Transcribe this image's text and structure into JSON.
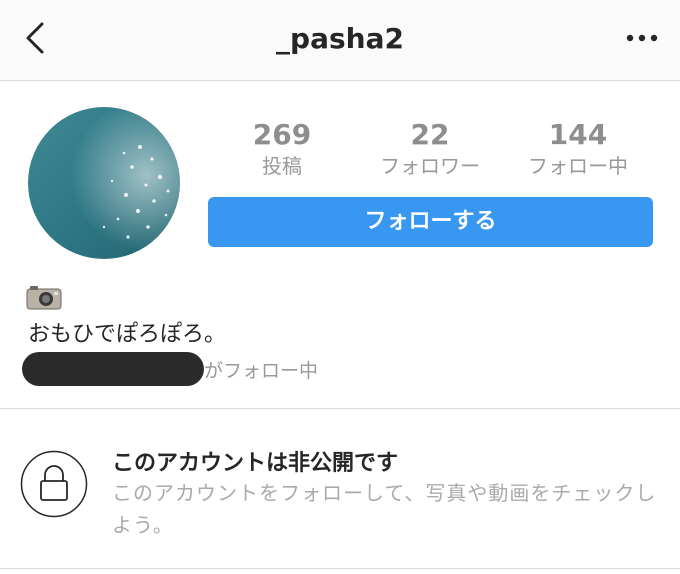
{
  "header": {
    "back_icon": "chevron-left-icon",
    "title": "_pasha2",
    "more_icon": "more-horizontal-icon"
  },
  "profile": {
    "avatar_icon": "avatar-sea-photo",
    "stats": [
      {
        "value": "269",
        "label": "投稿"
      },
      {
        "value": "22",
        "label": "フォロワー"
      },
      {
        "value": "144",
        "label": "フォロー中"
      }
    ],
    "follow_label": "フォローする",
    "bio_icon": "camera-icon",
    "bio_text": "おもひでぽろぽろ。",
    "followed_by_suffix": "がフォロー中"
  },
  "private_notice": {
    "icon": "lock-icon",
    "title": "このアカウントは非公開です",
    "description": "このアカウントをフォローして、写真や動画をチェックしよう。"
  },
  "colors": {
    "accent": "#3897f0",
    "header_bg": "#fafafa",
    "muted_text": "#999999",
    "redaction": "#2b2b2b"
  }
}
